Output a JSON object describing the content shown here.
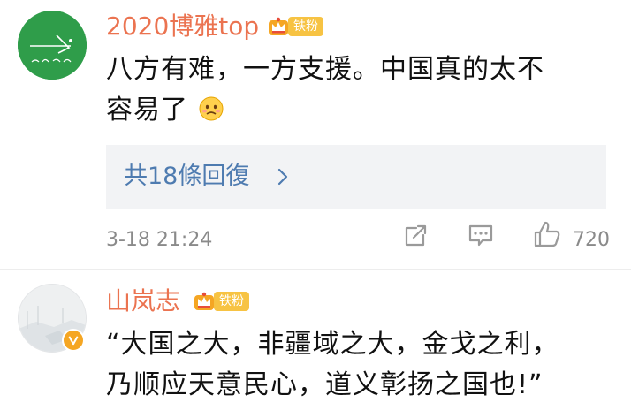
{
  "comments": [
    {
      "username": "2020博雅top",
      "badge_label": "铁粉",
      "text_line1": "八方有难，一方支援。中国真的太不",
      "text_line2": "容易了",
      "emoji": "sad-face-emoji",
      "replies_label": "共18條回復",
      "time": "3-18 21:24",
      "likes": "720"
    },
    {
      "username": "山岚志",
      "badge_label": "铁粉",
      "text_line1": "“大国之大，非疆域之大，金戈之利，",
      "text_line2": "乃顺应天意民心，道义彰扬之国也!”"
    }
  ],
  "icons": {
    "share": "share-icon",
    "comment": "comment-icon",
    "like": "thumbs-up-icon",
    "chevron": "chevron-right-icon",
    "crown": "crown-icon",
    "verified": "verified-badge-icon"
  },
  "colors": {
    "username": "#eb7350",
    "link": "#4e7bb0",
    "badge": "#f7c343",
    "meta": "#8a8a8a"
  }
}
